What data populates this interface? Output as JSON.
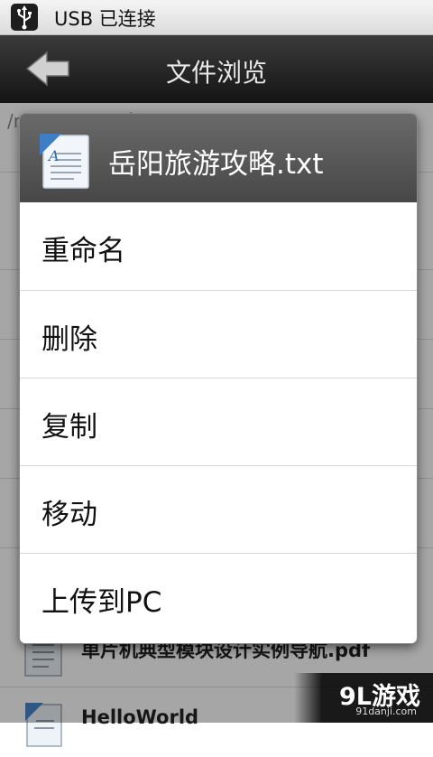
{
  "status_bar": {
    "icon": "usb-icon",
    "text": "USB 已连接"
  },
  "title_bar": {
    "back_icon": "back-arrow-icon",
    "title": "文件浏览"
  },
  "file_list": {
    "path": "/mnt/sdcard/桌面pc",
    "visible_files": [
      {
        "name": "单片机典型模块设计实例导航.pdf",
        "icon": "pdf-document-icon"
      },
      {
        "name": "HelloWorld",
        "icon": "read-document-icon"
      }
    ]
  },
  "dialog": {
    "file_icon": "read-document-icon",
    "title": "岳阳旅游攻略.txt",
    "menu": [
      {
        "label": "重命名"
      },
      {
        "label": "删除"
      },
      {
        "label": "复制"
      },
      {
        "label": "移动"
      },
      {
        "label": "上传到PC"
      }
    ]
  },
  "watermark": {
    "main": "9L游戏",
    "sub": "91danji.com"
  },
  "colors": {
    "title_bar": "#1e1e1e",
    "dialog_header": "#555555",
    "dim_overlay": "rgba(0,0,0,0.35)"
  }
}
